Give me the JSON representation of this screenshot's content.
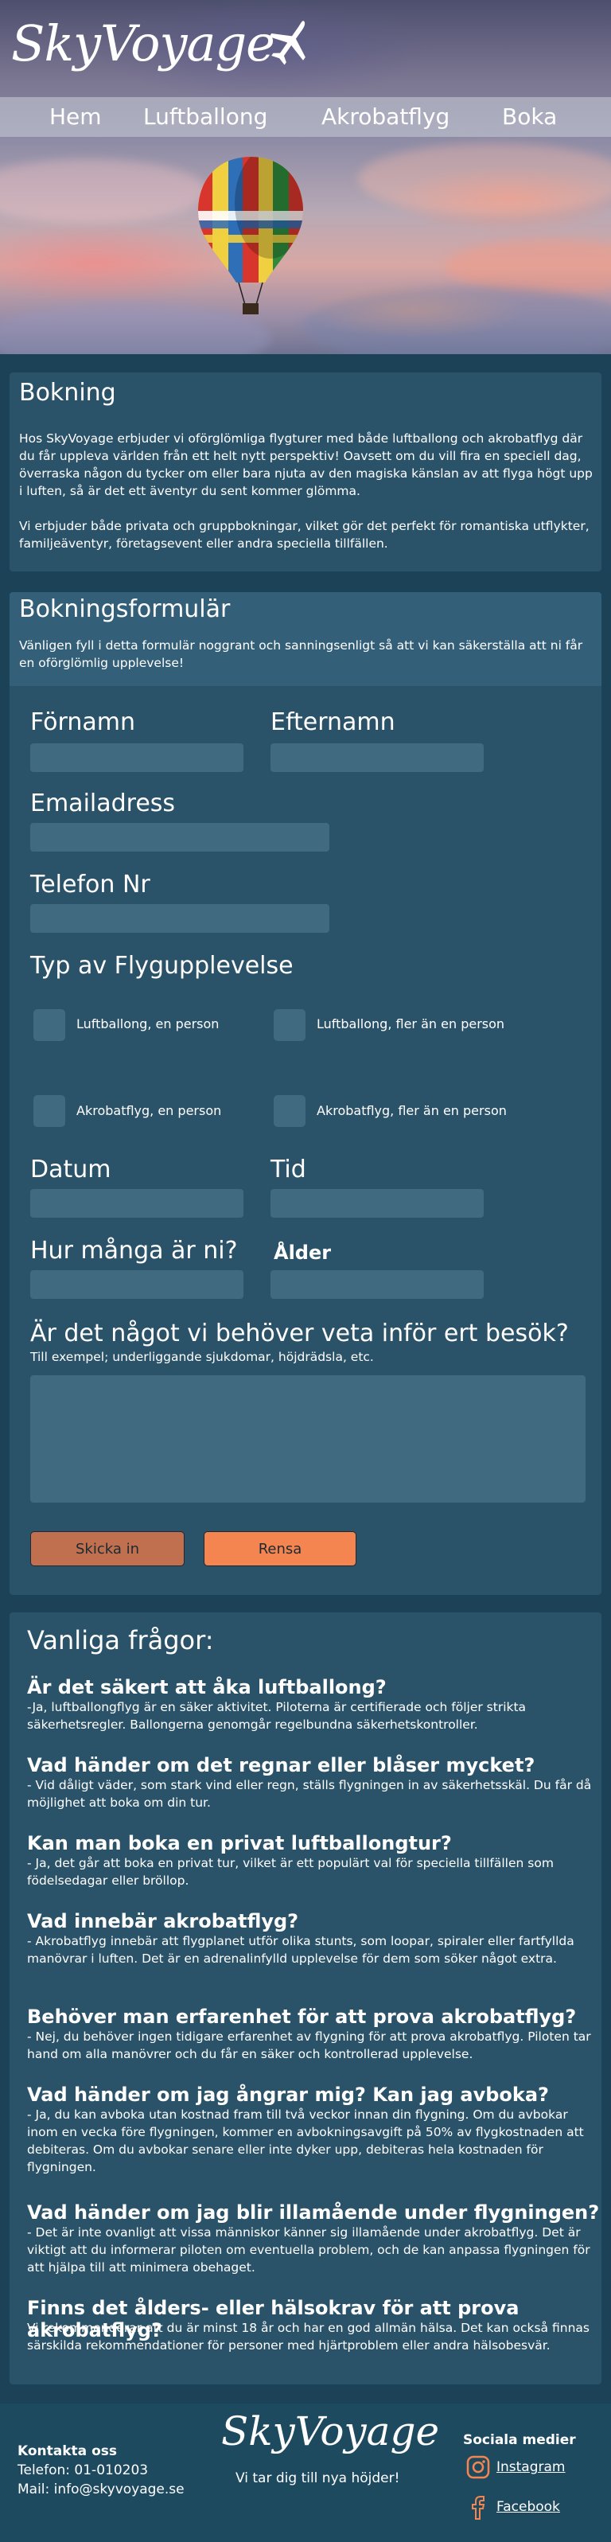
{
  "brand": {
    "name": "SkyVoyage",
    "tagline": "Vi tar dig till nya höjder!"
  },
  "nav": {
    "items": [
      "Hem",
      "Luftballong",
      "Akrobatflyg",
      "Boka"
    ]
  },
  "booking": {
    "title": "Bokning",
    "paragraph1": "Hos SkyVoyage erbjuder vi oförglömliga flygturer med både luftballong och akrobatflyg där du får uppleva världen från ett helt nytt perspektiv! Oavsett om du vill fira en speciell dag, överraska någon du tycker om eller bara njuta av den magiska känslan av att flyga högt upp i luften, så är det ett äventyr du sent kommer glömma.",
    "paragraph2": "Vi erbjuder både privata och gruppbokningar, vilket gör det perfekt för romantiska utflykter, familjeäventyr, företagsevent eller andra speciella tillfällen."
  },
  "form": {
    "title": "Bokningsformulär",
    "intro": "Vänligen fyll i detta formulär noggrant och sanningsenligt så att vi kan säkerställa att ni får en oförglömlig upplevelse!",
    "first_name": "Förnamn",
    "last_name": "Efternamn",
    "email": "Emailadress",
    "phone": "Telefon Nr",
    "type_label": "Typ av Flygupplevelse",
    "options": [
      "Luftballong, en person",
      "Luftballong, fler än en person",
      "Akrobatflyg, en person",
      "Akrobatflyg, fler än en person"
    ],
    "date": "Datum",
    "time": "Tid",
    "how_many": "Hur många är ni?",
    "age": "Ålder",
    "notes_label": "Är det något vi behöver veta inför ert besök?",
    "notes_hint": "Till exempel; underliggande sjukdomar, höjdrädsla, etc.",
    "submit": "Skicka in",
    "reset": "Rensa"
  },
  "faq": {
    "title": "Vanliga frågor:",
    "items": [
      {
        "q": "Är det säkert att åka luftballong?",
        "a": "-Ja, luftballongflyg är en säker aktivitet. Piloterna är certifierade och följer strikta säkerhetsregler. Ballongerna genomgår regelbundna säkerhetskontroller."
      },
      {
        "q": "Vad händer om det regnar eller blåser mycket?",
        "a": "- Vid dåligt väder, som stark vind eller regn, ställs flygningen in av säkerhetsskäl. Du får då möjlighet att boka om din tur."
      },
      {
        "q": "Kan man boka en privat luftballongtur?",
        "a": "- Ja, det går att boka en privat tur, vilket är ett populärt val för speciella tillfällen som födelsedagar eller bröllop."
      },
      {
        "q": "Vad innebär akrobatflyg?",
        "a": "- Akrobatflyg innebär att flygplanet utför olika stunts, som loopar, spiraler eller fartfyllda manövrar i luften. Det är en adrenalinfylld    upplevelse för dem som söker något extra."
      },
      {
        "q": "Behöver man erfarenhet för att prova akrobatflyg?",
        "a": "- Nej, du behöver ingen tidigare erfarenhet av flygning för att prova akrobatflyg. Piloten tar hand om alla manövrer och du får en säker och kontrollerad upplevelse."
      },
      {
        "q": "Vad händer om jag ångrar mig? Kan jag avboka?",
        "a": "- Ja, du kan avboka utan kostnad fram till två veckor innan din flygning. Om du avbokar inom en vecka före flygningen, kommer en avbokningsavgift på 50% av flygkostnaden att debiteras. Om du avbokar senare eller inte dyker upp, debiteras hela kostnaden för flygningen."
      },
      {
        "q": "Vad händer om jag blir illamående under flygningen?",
        "a": "- Det är inte ovanligt att vissa människor känner sig illamående under akrobatflyg. Det är viktigt att du informerar piloten om eventuella problem, och de kan anpassa flygningen för att hjälpa till att minimera obehaget."
      },
      {
        "q": "Finns det ålders- eller hälsokrav för att prova akrobatflyg?",
        "a": "Vi rekommenderar att du är minst 18 år och har en god allmän hälsa. Det kan också finnas särskilda rekommendationer för personer med hjärtproblem eller andra hälsobesvär."
      }
    ]
  },
  "footer": {
    "contact_title": "Kontakta oss",
    "phone": "Telefon: 01-010203",
    "mail": "Mail: info@skyvoyage.se",
    "social_title": "Sociala medier",
    "instagram": "Instagram",
    "facebook": "Facebook"
  },
  "colors": {
    "background": "#1b4257",
    "card": "#2a5268",
    "field": "#3f6a80",
    "submit": "#c0704f",
    "reset": "#f58550"
  }
}
